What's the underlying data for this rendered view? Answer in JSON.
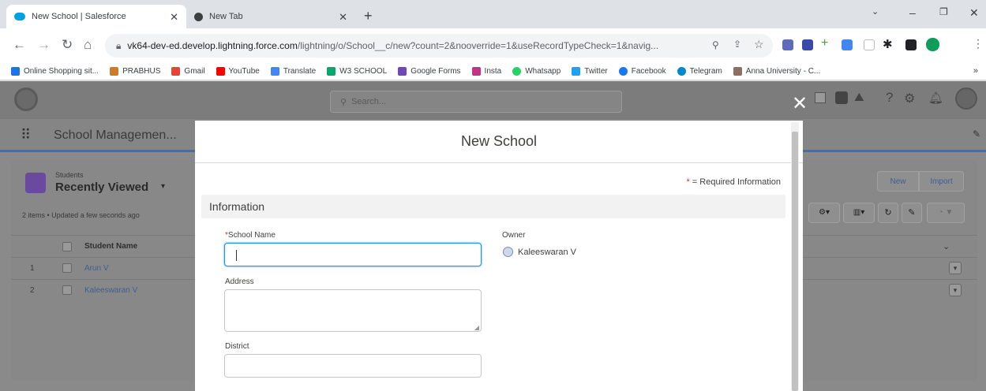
{
  "browser": {
    "tabs": [
      {
        "title": "New School | Salesforce",
        "active": true
      },
      {
        "title": "New Tab",
        "active": false
      }
    ],
    "new_tab_symbol": "+",
    "url_host": "vk64-dev-ed.develop.lightning.force.com",
    "url_path": "/lightning/o/School__c/new?count=2&nooverride=1&useRecordTypeCheck=1&navig...",
    "bookmarks": [
      {
        "label": "Online Shopping sit...",
        "color": "#1a73e8"
      },
      {
        "label": "PRABHUS",
        "color": "#d07b2a"
      },
      {
        "label": "Gmail",
        "color": "#ea4335"
      },
      {
        "label": "YouTube",
        "color": "#ff0000"
      },
      {
        "label": "Translate",
        "color": "#4285f4"
      },
      {
        "label": "W3 SCHOOL",
        "color": "#04aa6d"
      },
      {
        "label": "Google Forms",
        "color": "#7248b9"
      },
      {
        "label": "Insta",
        "color": "#c13584"
      },
      {
        "label": "Whatsapp",
        "color": "#25d366"
      },
      {
        "label": "Twitter",
        "color": "#1da1f2"
      },
      {
        "label": "Facebook",
        "color": "#1877f2"
      },
      {
        "label": "Telegram",
        "color": "#0088cc"
      },
      {
        "label": "Anna University - C...",
        "color": "#8d6e63"
      }
    ]
  },
  "salesforce": {
    "search_placeholder": "Search...",
    "app_name": "School Managemen...",
    "list_object": "Students",
    "list_view": "Recently Viewed",
    "list_meta": "2 items • Updated a few seconds ago",
    "column_header": "Student Name",
    "rows": [
      {
        "num": "1",
        "name": "Arun V"
      },
      {
        "num": "2",
        "name": "Kaleeswaran V"
      }
    ],
    "new_button": "New",
    "import_button": "Import"
  },
  "modal": {
    "title": "New School",
    "required_note": "= Required Information",
    "required_star": "*",
    "section_title": "Information",
    "fields": {
      "school_name_label": "School Name",
      "school_name_value": "",
      "address_label": "Address",
      "address_value": "",
      "district_label": "District",
      "district_value": "",
      "owner_label": "Owner",
      "owner_value": "Kaleeswaran V"
    }
  },
  "colors": {
    "accent_blue": "#1b96ff",
    "required_red": "#c23934"
  }
}
